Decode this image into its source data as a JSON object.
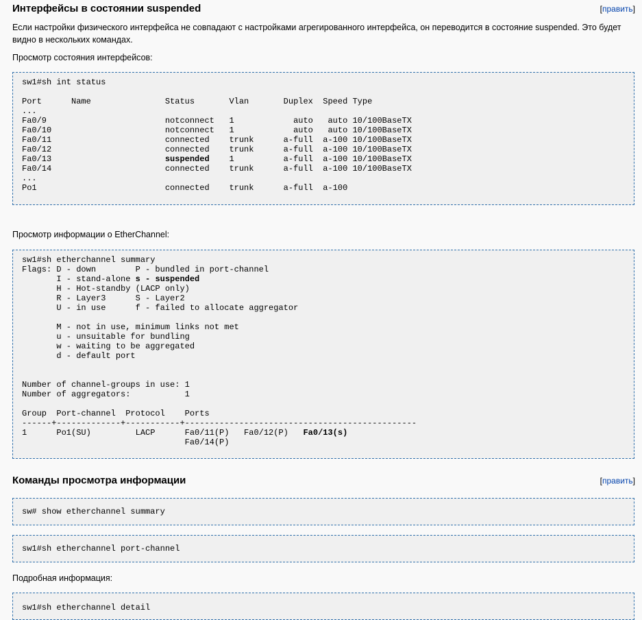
{
  "section1": {
    "heading": "Интерфейсы в состоянии suspended",
    "edit_label": "править",
    "intro": "Если настройки физического интерфейса не совпадают с настройками агрегированного интерфейса, он переводится в состояние suspended. Это будет видно в нескольких командах.",
    "status_caption": "Просмотр состояния интерфейсов:",
    "status_output": {
      "command": "sw1#sh int status",
      "header": "Port      Name               Status       Vlan       Duplex  Speed Type",
      "dots1": "...",
      "rows": [
        "Fa0/9                        notconnect   1            auto   auto 10/100BaseTX",
        "Fa0/10                       notconnect   1            auto   auto 10/100BaseTX",
        "Fa0/11                       connected    trunk      a-full  a-100 10/100BaseTX",
        "Fa0/12                       connected    trunk      a-full  a-100 10/100BaseTX"
      ],
      "suspended_row": {
        "pre": "Fa0/13                       ",
        "status": "suspended",
        "post": "    1          a-full  a-100 10/100BaseTX"
      },
      "rows2": [
        "Fa0/14                       connected    trunk      a-full  a-100 10/100BaseTX"
      ],
      "dots2": "...",
      "po_row": "Po1                          connected    trunk      a-full  a-100"
    },
    "ether_caption": "Просмотр информации о EtherChannel:",
    "ether_output": {
      "command": "sw1#sh etherchannel summary",
      "flags1": "Flags: D - down        P - bundled in port-channel",
      "flags2_pre": "       I - stand-alone ",
      "flags2_bold": "s - suspended",
      "flags3": "       H - Hot-standby (LACP only)",
      "flags4": "       R - Layer3      S - Layer2",
      "flags5": "       U - in use      f - failed to allocate aggregator",
      "blank": "",
      "flags6": "       M - not in use, minimum links not met",
      "flags7": "       u - unsuitable for bundling",
      "flags8": "       w - waiting to be aggregated",
      "flags9": "       d - default port",
      "groups": "Number of channel-groups in use: 1",
      "aggregators": "Number of aggregators:           1",
      "table_header": "Group  Port-channel  Protocol    Ports",
      "table_rule": "------+-------------+-----------+-----------------------------------------------",
      "row_pre": "1      Po1(SU)         LACP      Fa0/11(P)   Fa0/12(P)   ",
      "row_bold": "Fa0/13(s)",
      "row_cont": "                                 Fa0/14(P)"
    }
  },
  "section2": {
    "heading": "Команды просмотра информации",
    "edit_label": "править",
    "cmd1": "sw# show etherchannel summary",
    "cmd2": "sw1#sh etherchannel port-channel",
    "detail_caption": "Подробная информация:",
    "cmd3": "sw1#sh etherchannel detail"
  }
}
